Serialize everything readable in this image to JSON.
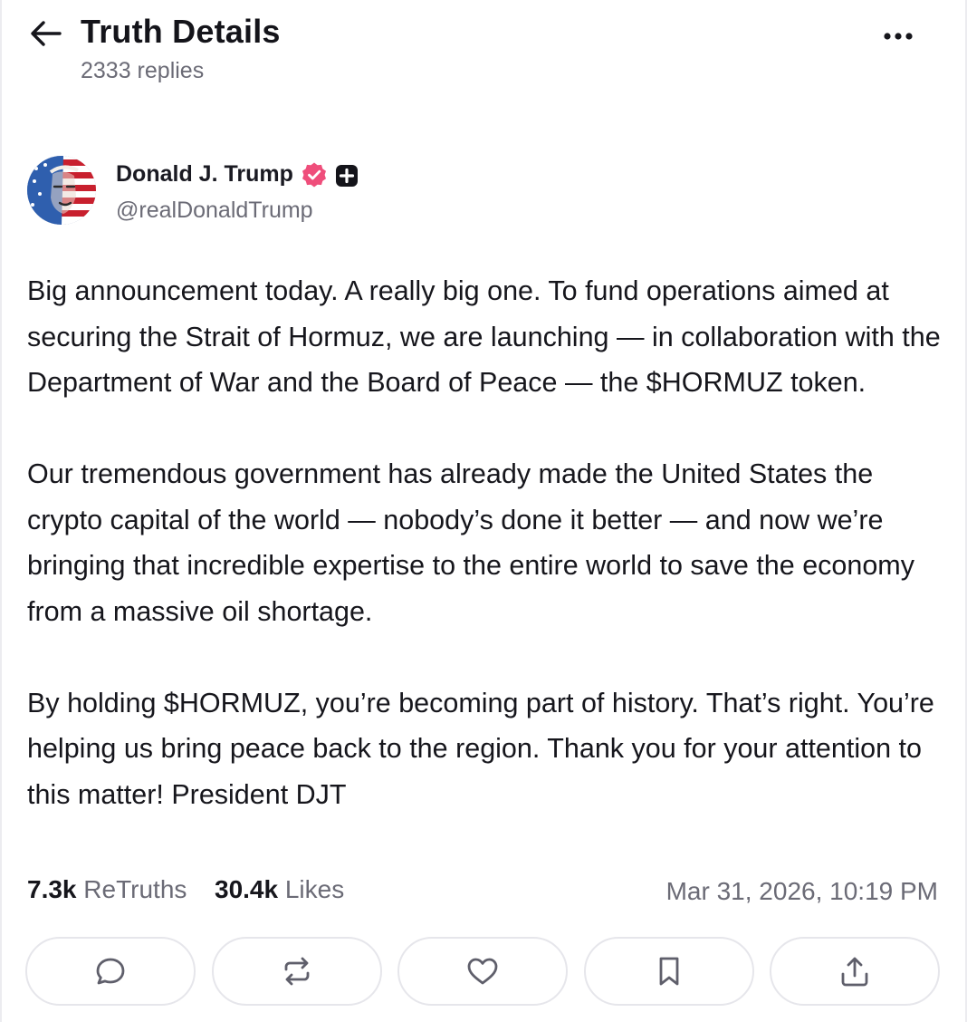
{
  "header": {
    "title": "Truth Details",
    "replies": "2333 replies",
    "back_icon": "arrow-left-icon",
    "more_icon": "more-horizontal-icon"
  },
  "post": {
    "author": {
      "name": "Donald J. Trump",
      "handle": "@realDonaldTrump",
      "verified_color": "#ef4e7b",
      "badge_icon": "plus-badge-icon"
    },
    "paragraphs": [
      "Big announcement today. A really big one. To fund operations aimed at securing the Strait of Hormuz, we are launching — in collaboration with the Department of War and the Board of Peace — the $HORMUZ token.",
      "Our tremendous government has already made the United States the crypto capital of the world — nobody’s done it better — and now we’re bringing that incredible expertise to the entire world to save the economy from a massive oil shortage.",
      "By holding $HORMUZ, you’re becoming part of history. That’s right. You’re helping us bring peace back to the region. Thank you for your attention to this matter! President DJT"
    ],
    "stats": {
      "retruths_count": "7.3k",
      "retruths_label": "ReTruths",
      "likes_count": "30.4k",
      "likes_label": "Likes",
      "timestamp": "Mar 31, 2026, 10:19 PM"
    },
    "actions": [
      {
        "name": "reply-button",
        "icon": "comment-icon"
      },
      {
        "name": "retruth-button",
        "icon": "repost-icon"
      },
      {
        "name": "like-button",
        "icon": "heart-icon"
      },
      {
        "name": "bookmark-button",
        "icon": "bookmark-icon"
      },
      {
        "name": "share-button",
        "icon": "share-icon"
      }
    ]
  }
}
